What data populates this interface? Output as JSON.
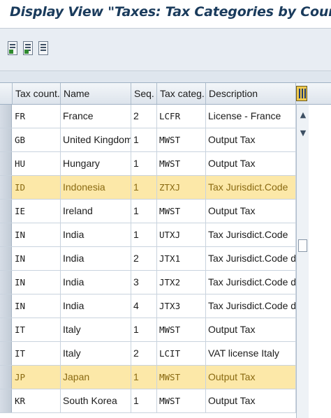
{
  "window": {
    "title": "Display View \"Taxes: Tax Categories by Country\": Overview"
  },
  "toolbar": {
    "icons": [
      "select-all-icon",
      "select-block-icon",
      "deselect-all-icon"
    ]
  },
  "table": {
    "columns": [
      "Tax count.",
      "Name",
      "Seq.",
      "Tax categ.",
      "Description"
    ],
    "rows": [
      {
        "country": "FR",
        "name": "France",
        "seq": "2",
        "categ": "LCFR",
        "desc": "License - France",
        "highlighted": false
      },
      {
        "country": "GB",
        "name": "United Kingdom",
        "seq": "1",
        "categ": "MWST",
        "desc": "Output Tax",
        "highlighted": false
      },
      {
        "country": "HU",
        "name": "Hungary",
        "seq": "1",
        "categ": "MWST",
        "desc": "Output Tax",
        "highlighted": false
      },
      {
        "country": "ID",
        "name": "Indonesia",
        "seq": "1",
        "categ": "ZTXJ",
        "desc": "Tax Jurisdict.Code",
        "highlighted": true
      },
      {
        "country": "IE",
        "name": "Ireland",
        "seq": "1",
        "categ": "MWST",
        "desc": "Output Tax",
        "highlighted": false
      },
      {
        "country": "IN",
        "name": "India",
        "seq": "1",
        "categ": "UTXJ",
        "desc": "Tax Jurisdict.Code",
        "highlighted": false
      },
      {
        "country": "IN",
        "name": "India",
        "seq": "2",
        "categ": "JTX1",
        "desc": "Tax Jurisdict.Code d",
        "highlighted": false
      },
      {
        "country": "IN",
        "name": "India",
        "seq": "3",
        "categ": "JTX2",
        "desc": "Tax Jurisdict.Code d",
        "highlighted": false
      },
      {
        "country": "IN",
        "name": "India",
        "seq": "4",
        "categ": "JTX3",
        "desc": "Tax Jurisdict.Code d",
        "highlighted": false
      },
      {
        "country": "IT",
        "name": "Italy",
        "seq": "1",
        "categ": "MWST",
        "desc": "Output Tax",
        "highlighted": false
      },
      {
        "country": "IT",
        "name": "Italy",
        "seq": "2",
        "categ": "LCIT",
        "desc": "VAT license Italy",
        "highlighted": false
      },
      {
        "country": "JP",
        "name": "Japan",
        "seq": "1",
        "categ": "MWST",
        "desc": "Output Tax",
        "highlighted": true
      },
      {
        "country": "KR",
        "name": "South Korea",
        "seq": "1",
        "categ": "MWST",
        "desc": "Output Tax",
        "highlighted": false
      }
    ]
  },
  "scrollbar": {
    "up_arrow": "▲",
    "down_arrow": "▼"
  },
  "colors": {
    "highlight_row": "#fce8a8",
    "highlight_text": "#8a6a12",
    "title_text": "#1a3b5c"
  }
}
